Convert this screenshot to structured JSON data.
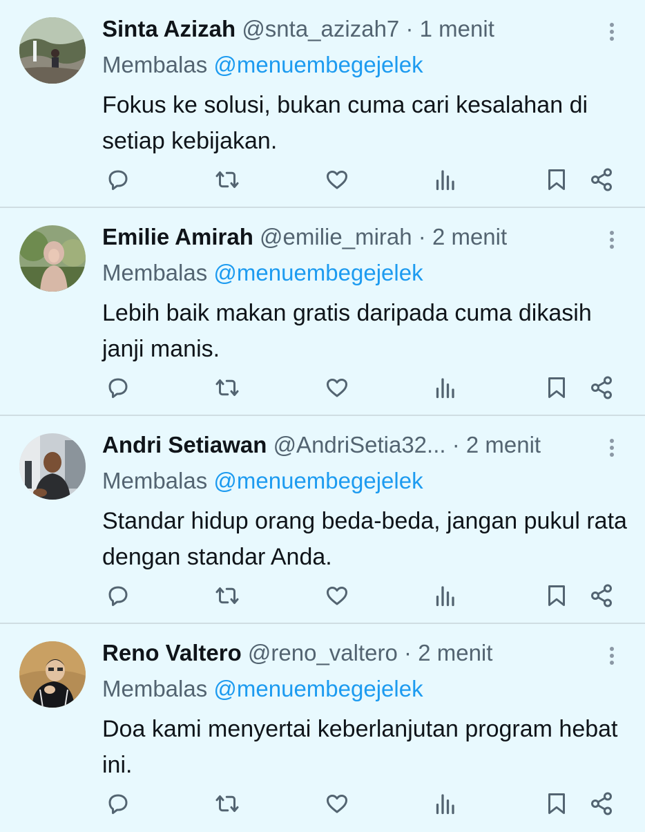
{
  "tweets": [
    {
      "name": "Sinta Azizah",
      "handle": "@snta_azizah7",
      "dot": "·",
      "time": "1 menit",
      "replying_prefix": "Membalas",
      "replying_to": "@menuembegejelek",
      "text": "Fokus ke solusi, bukan cuma cari kesalahan di setiap kebijakan."
    },
    {
      "name": "Emilie Amirah",
      "handle": "@emilie_mirah",
      "dot": "·",
      "time": "2 menit",
      "replying_prefix": "Membalas",
      "replying_to": "@menuembegejelek",
      "text": "Lebih baik makan gratis daripada cuma dikasih janji manis."
    },
    {
      "name": "Andri Setiawan",
      "handle": "@AndriSetia32...",
      "dot": "·",
      "time": "2 menit",
      "replying_prefix": "Membalas",
      "replying_to": "@menuembegejelek",
      "text": "Standar hidup orang beda-beda, jangan pukul rata dengan standar Anda."
    },
    {
      "name": "Reno Valtero",
      "handle": "@reno_valtero",
      "dot": "·",
      "time": "2 menit",
      "replying_prefix": "Membalas",
      "replying_to": "@menuembegejelek",
      "text": "Doa kami menyertai keberlanjutan program hebat ini."
    }
  ],
  "icons": {
    "reply": "reply-icon",
    "retweet": "retweet-icon",
    "like": "heart-icon",
    "views": "views-icon",
    "bookmark": "bookmark-icon",
    "share": "share-icon",
    "more": "more-icon"
  },
  "colors": {
    "background": "#e8f9fe",
    "name": "#0f1419",
    "muted": "#536471",
    "mention": "#1d9bf0",
    "icon": "#536471",
    "divider": "#cfdde2"
  }
}
